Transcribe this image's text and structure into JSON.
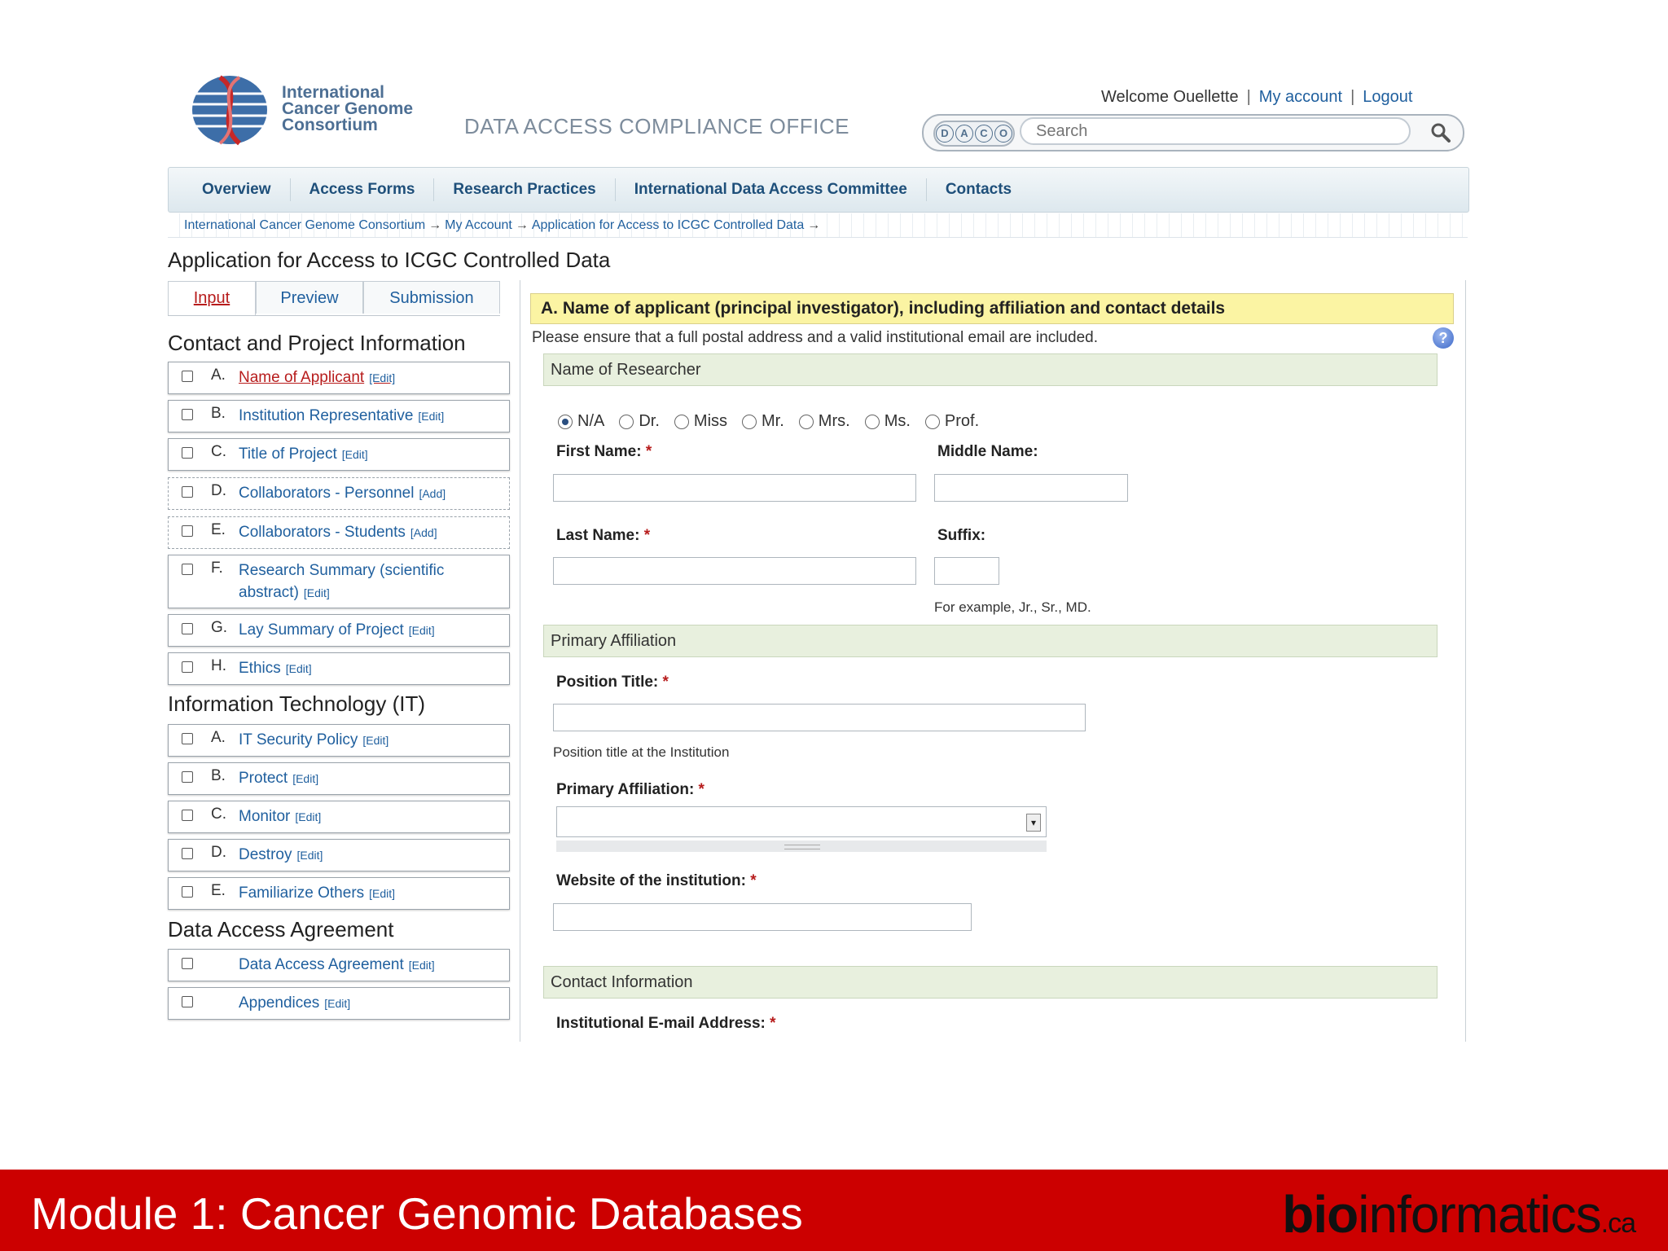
{
  "header": {
    "logo_text": [
      "International",
      "Cancer Genome",
      "Consortium"
    ],
    "office": "DATA ACCESS COMPLIANCE OFFICE",
    "welcome": "Welcome Ouellette",
    "my_account": "My account",
    "logout": "Logout",
    "daco_letters": [
      "D",
      "A",
      "C",
      "O"
    ],
    "search_placeholder": "Search"
  },
  "nav": [
    "Overview",
    "Access Forms",
    "Research Practices",
    "International Data Access Committee",
    "Contacts"
  ],
  "breadcrumb": [
    "International Cancer Genome Consortium",
    "My Account",
    "Application for Access to ICGC Controlled Data"
  ],
  "page_title": "Application for Access to ICGC Controlled Data",
  "tabs": [
    "Input",
    "Preview",
    "Submission"
  ],
  "sidebar": {
    "contact_heading": "Contact and Project Information",
    "contact_items": [
      {
        "letter": "A.",
        "label": "Name of Applicant",
        "action": "[Edit]"
      },
      {
        "letter": "B.",
        "label": "Institution Representative",
        "action": "[Edit]"
      },
      {
        "letter": "C.",
        "label": "Title of Project",
        "action": "[Edit]"
      },
      {
        "letter": "D.",
        "label": "Collaborators - Personnel",
        "action": "[Add]"
      },
      {
        "letter": "E.",
        "label": "Collaborators - Students",
        "action": "[Add]"
      },
      {
        "letter": "F.",
        "label": "Research Summary (scientific",
        "label2": "abstract)",
        "action": "[Edit]"
      },
      {
        "letter": "G.",
        "label": "Lay Summary of Project",
        "action": "[Edit]"
      },
      {
        "letter": "H.",
        "label": "Ethics",
        "action": "[Edit]"
      }
    ],
    "it_heading": "Information Technology (IT)",
    "it_items": [
      {
        "letter": "A.",
        "label": "IT Security Policy",
        "action": "[Edit]"
      },
      {
        "letter": "B.",
        "label": "Protect",
        "action": "[Edit]"
      },
      {
        "letter": "C.",
        "label": "Monitor",
        "action": "[Edit]"
      },
      {
        "letter": "D.",
        "label": "Destroy",
        "action": "[Edit]"
      },
      {
        "letter": "E.",
        "label": "Familiarize Others",
        "action": "[Edit]"
      }
    ],
    "daa_heading": "Data Access Agreement",
    "daa_items": [
      {
        "label": "Data Access Agreement",
        "action": "[Edit]"
      },
      {
        "label": "Appendices",
        "action": "[Edit]"
      }
    ]
  },
  "form": {
    "section_title": "A.  Name of applicant (principal investigator), including affiliation and contact details",
    "note": "Please ensure that a full postal address and a valid institutional email are included.",
    "help": "?",
    "researcher_heading": "Name of Researcher",
    "titles": [
      "N/A",
      "Dr.",
      "Miss",
      "Mr.",
      "Mrs.",
      "Ms.",
      "Prof."
    ],
    "selected_title": "N/A",
    "first_name": "First Name:",
    "middle_name": "Middle Name:",
    "last_name": "Last Name:",
    "suffix": "Suffix:",
    "suffix_hint": "For example, Jr., Sr., MD.",
    "required_mark": "*",
    "affiliation_heading": "Primary Affiliation",
    "position_title": "Position Title:",
    "position_hint": "Position title at the Institution",
    "primary_affiliation": "Primary Affiliation:",
    "website": "Website of the institution:",
    "contact_heading": "Contact Information",
    "email": "Institutional E-mail Address:"
  },
  "footer": {
    "title": "Module 1: Cancer Genomic Databases",
    "brand_bold": "bio",
    "brand_rest": "informatics",
    "brand_suffix": ".ca"
  },
  "colors": {
    "footer_red": "#cc0000",
    "link_blue": "#1f5f9e",
    "active_red": "#b71c1c",
    "section_yellow": "#fbf4a3",
    "subhead_green": "#e8f0de"
  }
}
